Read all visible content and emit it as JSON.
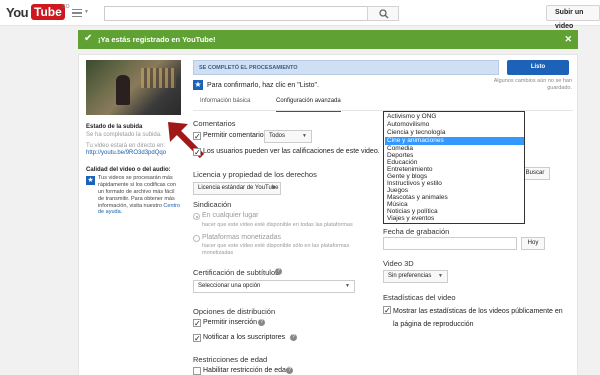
{
  "topbar": {
    "logo_you": "You",
    "logo_tube": "Tube",
    "logo_region": "CO",
    "search_placeholder": "",
    "upload_label": "Subir un video"
  },
  "banner": {
    "message": "¡Ya estás registrado en YouTube!"
  },
  "sidebar": {
    "status_title": "Estado de la subida",
    "status_text": "Se ha completado la subida.",
    "live_label": "Tu video estará en directo en:",
    "video_url": "http://youtu.be/9RO3d3pdQqo",
    "quality_title": "Calidad del video o del audio:",
    "quality_text": "Tus videos se procesarán más rápidamente si los codificas con un formato de archivo más fácil de transmitir. Para obtener más información, visita nuestro",
    "help_link": "Centro de ayuda."
  },
  "upload": {
    "progress_label": "SE COMPLETÓ EL PROCESAMIENTO",
    "progress_fraction": 1.0,
    "done_button": "Listo",
    "unsaved_note": "Algunos cambios aún no se han guardado.",
    "confirm_text": "Para confirmarlo, haz clic en \"Listo\"."
  },
  "tabs": [
    {
      "label": "Información básica"
    },
    {
      "label": "Configuración avanzada"
    }
  ],
  "left": {
    "comments_title": "Comentarios",
    "allow_comments": "Permitir comentarios",
    "comments_select": "Todos",
    "ratings_label": "Los usuarios pueden ver las calificaciones de este video.",
    "license_title": "Licencia y propiedad de los derechos",
    "license_select": "Licencia estándar de YouTube",
    "syndication_title": "Sindicación",
    "synd_everywhere": "En cualquier lugar",
    "synd_everywhere_desc": "hacer que este video esté disponible en todas las plataformas",
    "synd_monetized": "Plataformas monetizadas",
    "synd_monetized_desc": "hacer que este video esté disponible sólo en las plataformas monetizadas",
    "captions_title": "Certificación de subtítulos",
    "captions_select": "Seleccionar una opción",
    "distribution_title": "Opciones de distribución",
    "allow_embed": "Permitir inserción",
    "notify_subs": "Notificar a los suscriptores",
    "age_title": "Restricciones de edad",
    "age_enable": "Habilitar restricción de edad"
  },
  "right": {
    "category_options": [
      "Activismo y ONG",
      "Automovilismo",
      "Ciencia y tecnología",
      "Cine y animaciones",
      "Comedia",
      "Deportes",
      "Educación",
      "Entretenimiento",
      "Gente y blogs",
      "Instructivos y estilo",
      "Juegos",
      "Mascotas y animales",
      "Música",
      "Noticias y política",
      "Viajes y eventos"
    ],
    "category_selected": "Cine y animaciones",
    "search_button": "Buscar",
    "recording_date_title": "Fecha de grabación",
    "today_button": "Hoy",
    "video3d_title": "Video 3D",
    "video3d_select": "Sin preferencias",
    "stats_title": "Estadísticas del video",
    "stats_text": "Mostrar las estadísticas de los videos públicamente en la página de reproducción"
  },
  "colors": {
    "banner_green": "#5fa233",
    "brand_red": "#cc181e",
    "primary_blue": "#1c62b9",
    "highlight_blue": "#3399ff"
  }
}
